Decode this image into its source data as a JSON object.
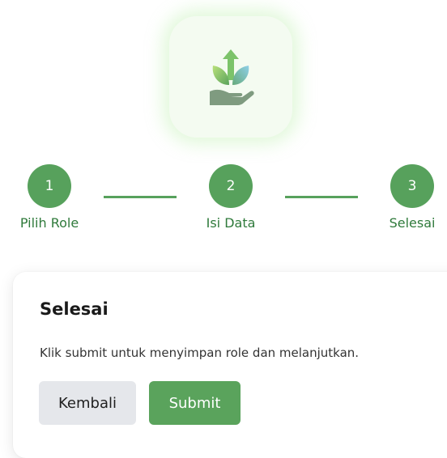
{
  "logo": {
    "icon": "plant-in-hand-icon"
  },
  "stepper": {
    "steps": [
      {
        "number": "1",
        "label": "Pilih Role"
      },
      {
        "number": "2",
        "label": "Isi Data"
      },
      {
        "number": "3",
        "label": "Selesai"
      }
    ],
    "color": "#57a15c"
  },
  "card": {
    "title": "Selesai",
    "description": "Klik submit untuk menyimpan role dan melanjutkan.",
    "back_label": "Kembali",
    "submit_label": "Submit"
  },
  "colors": {
    "primary": "#57a15c",
    "secondary_button": "#e5e7eb",
    "label": "#2f7a3b"
  }
}
